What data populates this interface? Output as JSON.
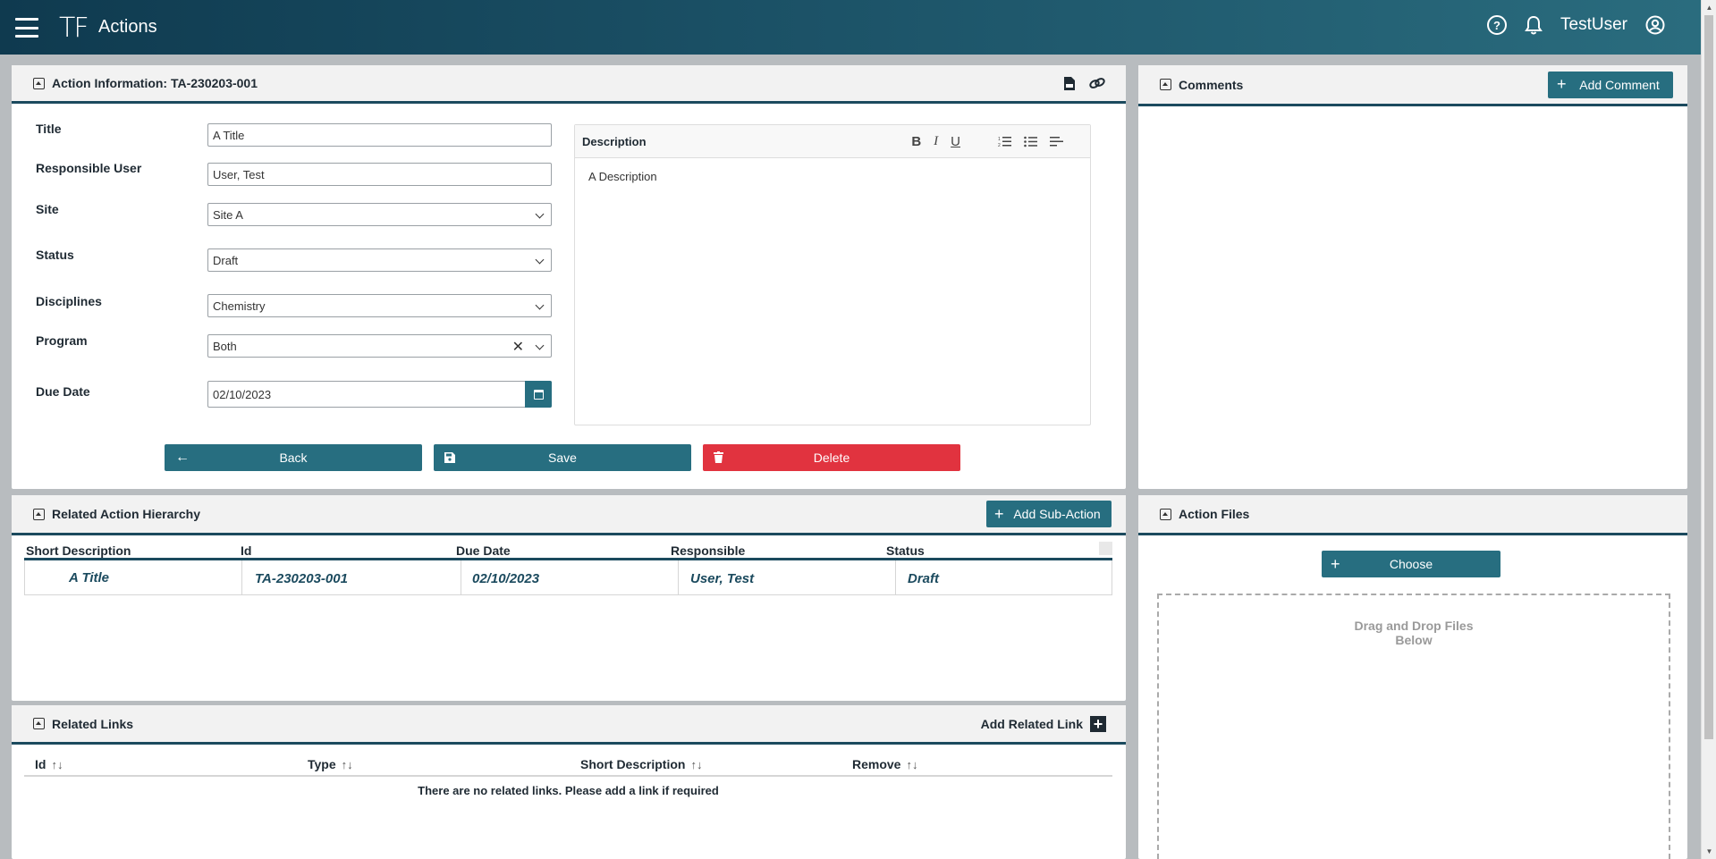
{
  "topbar": {
    "logo": "TF",
    "title": "Actions",
    "username": "TestUser",
    "help_icon": "?"
  },
  "action_info": {
    "title": "Action Information: TA-230203-001",
    "fields": {
      "title_label": "Title",
      "title_value": "A Title",
      "responsible_label": "Responsible User",
      "responsible_value": "User, Test",
      "site_label": "Site",
      "site_value": "Site A",
      "status_label": "Status",
      "status_value": "Draft",
      "disciplines_label": "Disciplines",
      "disciplines_value": "Chemistry",
      "program_label": "Program",
      "program_value": "Both",
      "due_date_label": "Due Date",
      "due_date_value": "02/10/2023"
    },
    "description": {
      "label": "Description",
      "value": "A Description",
      "bold": "B",
      "italic": "I",
      "underline": "U"
    },
    "buttons": {
      "back": "Back",
      "save": "Save",
      "delete": "Delete"
    }
  },
  "comments": {
    "title": "Comments",
    "add_label": "Add Comment"
  },
  "hierarchy": {
    "title": "Related Action Hierarchy",
    "add_label": "Add Sub-Action",
    "columns": [
      "Short Description",
      "Id",
      "Due Date",
      "Responsible",
      "Status"
    ],
    "rows": [
      [
        "A Title",
        "TA-230203-001",
        "02/10/2023",
        "User, Test",
        "Draft"
      ]
    ]
  },
  "related_links": {
    "title": "Related Links",
    "add_label": "Add Related Link",
    "columns": [
      "Id",
      "Type",
      "Short Description",
      "Remove"
    ],
    "empty_message": "There are no related links. Please add a link if required"
  },
  "files": {
    "title": "Action Files",
    "choose_label": "Choose",
    "drop_line1": "Drag and Drop Files",
    "drop_line2": "Below"
  },
  "colors": {
    "primary": "#276e80",
    "header_dark": "#0f3a4f",
    "danger": "#e1333f"
  }
}
